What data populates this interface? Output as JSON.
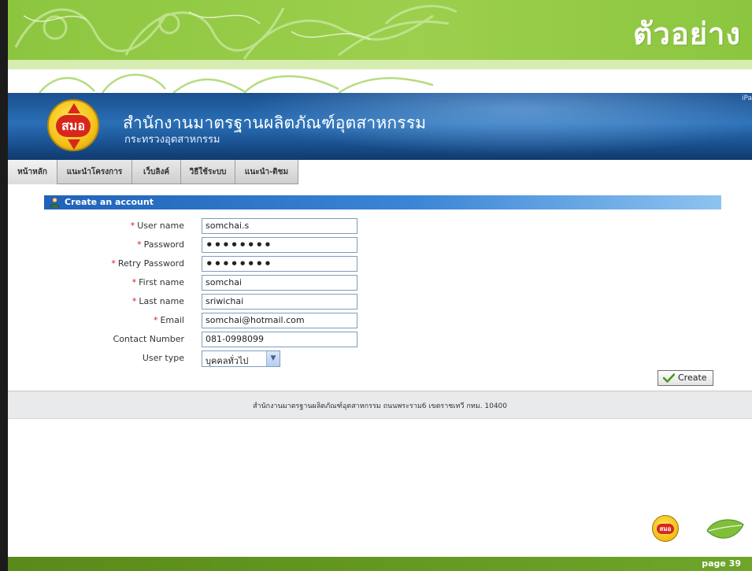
{
  "slide": {
    "title": "ตัวอย่าง",
    "page_label": "page 39"
  },
  "site": {
    "logo_text": "สมอ",
    "org_name": "สำนักงานมาตรฐานผลิตภัณฑ์อุตสาหกรรม",
    "org_sub": "กระทรวงอุตสาหกรรม",
    "corner_text": "iPa"
  },
  "nav": {
    "items": [
      {
        "label": "หน้าหลัก"
      },
      {
        "label": "แนะนำโครงการ"
      },
      {
        "label": "เว็บลิงค์"
      },
      {
        "label": "วิธีใช้ระบบ"
      },
      {
        "label": "แนะนำ-ติชม"
      }
    ]
  },
  "form": {
    "title": "Create an account",
    "fields": [
      {
        "label": "User name",
        "required": "*",
        "value": "somchai.s"
      },
      {
        "label": "Password",
        "required": "*",
        "value": "••••••••"
      },
      {
        "label": "Retry Password",
        "required": "*",
        "value": "••••••••"
      },
      {
        "label": "First name",
        "required": "*",
        "value": "somchai"
      },
      {
        "label": "Last name",
        "required": "*",
        "value": "sriwichai"
      },
      {
        "label": "Email",
        "required": "*",
        "value": "somchai@hotmail.com"
      },
      {
        "label": "Contact Number",
        "required": "",
        "value": "081-0998099"
      }
    ],
    "user_type": {
      "label": "User type",
      "selected": "บุคคลทั่วไป"
    },
    "create_label": "Create"
  },
  "footer": {
    "address": "สำนักงานมาตรฐานผลิตภัณฑ์อุตสาหกรรม ถนนพระราม6 เขตราชเทวี กทม. 10400"
  },
  "colors": {
    "banner_green": "#8cc63f",
    "header_blue": "#1a4f8e",
    "panel_blue": "#1f63b8",
    "required_red": "#d51b1b"
  },
  "icons": [
    "user-icon",
    "check-icon",
    "chevron-down-icon",
    "leaf-icon"
  ]
}
